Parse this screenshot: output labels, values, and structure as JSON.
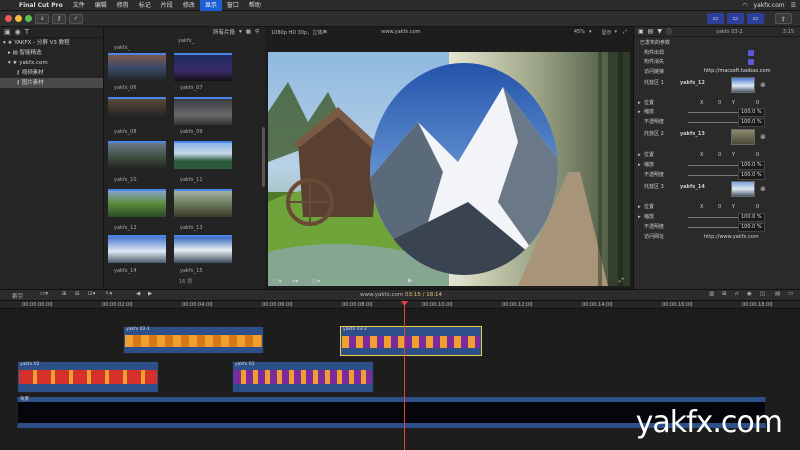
{
  "menubar": {
    "items": [
      "Final Cut Pro",
      "文件",
      "编辑",
      "修剪",
      "标记",
      "片段",
      "修改",
      "显示",
      "窗口",
      "帮助"
    ],
    "active_index": 7,
    "right_text": "yakfx.com"
  },
  "library": {
    "root": "YAKFX - 分屏 V3 教程",
    "items": [
      "智能精选",
      "yakfx.com",
      "视频素材",
      "图片素材"
    ],
    "selected_index": 3
  },
  "browser": {
    "filter": "所有片段",
    "thumbs": [
      "yakfx_",
      "yakfx_06",
      "yakfx_07",
      "yakfx_08",
      "yakfx_09",
      "yakfx_10",
      "yakfx_11",
      "yakfx_12",
      "yakfx_13",
      "yakfx_14",
      "yakfx_15"
    ],
    "count": "16 项"
  },
  "viewer": {
    "format": "1080p HD 30p，立体声",
    "title": "www.yakfx.com",
    "zoom": "45%",
    "display": "显示",
    "timecode": "9:17"
  },
  "inspector": {
    "clip_name": "yakfx 03-2",
    "duration": "3:15",
    "section_title": "已发布的参数",
    "rows": [
      {
        "label": "构件出现",
        "type": "check"
      },
      {
        "label": "构件消失",
        "type": "check"
      },
      {
        "label": "访问链接",
        "value": "http://macsoft.taobao.com"
      },
      {
        "label": "托放区 1",
        "value": "yakfx_12"
      },
      {
        "label": "位置",
        "x": "0",
        "y": "0"
      },
      {
        "label": "缩放",
        "value": "100.0 %"
      },
      {
        "label": "不透明度",
        "value": "100.0 %"
      },
      {
        "label": "托放区 2",
        "value": "yakfx_13"
      },
      {
        "label": "位置",
        "x": "0",
        "y": "0"
      },
      {
        "label": "缩放",
        "value": "100.0 %"
      },
      {
        "label": "不透明度",
        "value": "100.0 %"
      },
      {
        "label": "托放区 3",
        "value": "yakfx_14"
      },
      {
        "label": "位置",
        "x": "0",
        "y": "0"
      },
      {
        "label": "缩放",
        "value": "100.0 %"
      },
      {
        "label": "不透明度",
        "value": "100.0 %"
      },
      {
        "label": "访问网址",
        "value": "http://www.yakfx.com"
      }
    ],
    "axis_x": "X",
    "axis_y": "Y"
  },
  "timeline": {
    "index_label": "索引",
    "project": "www.yakfx.com",
    "position": "03:15 / 18:14",
    "ruler": [
      "00:00:00:00",
      "00:00:02:00",
      "00:00:04:00",
      "00:00:06:00",
      "00:00:08:00",
      "00:00:10:00",
      "00:00:12:00",
      "00:00:14:00",
      "00:00:16:00",
      "00:00:18:00"
    ],
    "clips": [
      {
        "name": "yakfx 02-1"
      },
      {
        "name": "yakfx 03-2"
      },
      {
        "name": "yakfx 02"
      },
      {
        "name": "yakfx 03"
      },
      {
        "name": "背景"
      }
    ]
  },
  "watermark": "yakfx.com",
  "colors": {
    "accent": "#1f5fd6",
    "playhead": "#e0453a",
    "clip_blue": "#2b4f86",
    "clip_orange": "#f0a030",
    "clip_red": "#d6302a",
    "clip_purple": "#7b2aa0",
    "selection": "#f2cc4a"
  }
}
